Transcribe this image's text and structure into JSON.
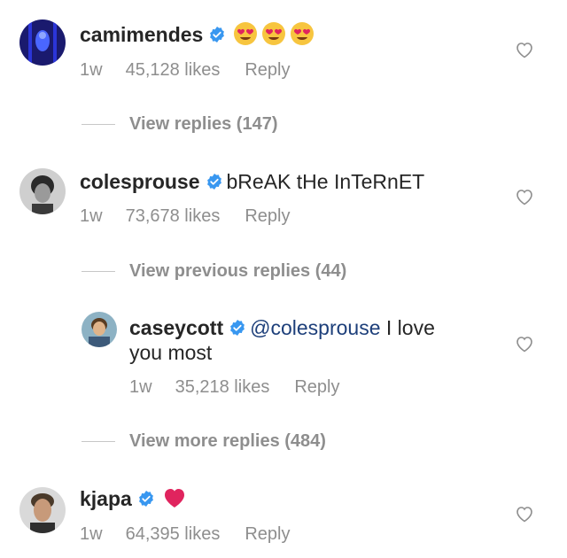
{
  "comments": [
    {
      "username": "camimendes",
      "text": "",
      "emoji": [
        "heart-eyes",
        "heart-eyes",
        "heart-eyes"
      ],
      "time": "1w",
      "likes": "45,128 likes",
      "reply": "Reply"
    },
    {
      "username": "colesprouse",
      "text": "bReAK tHe InTeRnET",
      "time": "1w",
      "likes": "73,678 likes",
      "reply": "Reply"
    },
    {
      "username": "caseycott",
      "mention": "@colesprouse",
      "text_rest": " I love",
      "text_line2": "you most",
      "time": "1w",
      "likes": "35,218 likes",
      "reply": "Reply"
    },
    {
      "username": "kjapa",
      "emoji": [
        "red-heart"
      ],
      "time": "1w",
      "likes": "64,395 likes",
      "reply": "Reply"
    }
  ],
  "view_replies": [
    "View replies (147)",
    "View previous replies (44)",
    "View more replies (484)"
  ],
  "colors": {
    "text": "#262626",
    "muted": "#8e8e8e",
    "verified_blue": "#3897f0",
    "mention": "#1d3f7a",
    "like_heart_outline": "#8e8e8e",
    "emoji_heart": "#e0245e"
  },
  "icons": {
    "verified": "verified-badge-icon",
    "like": "heart-outline-icon"
  }
}
